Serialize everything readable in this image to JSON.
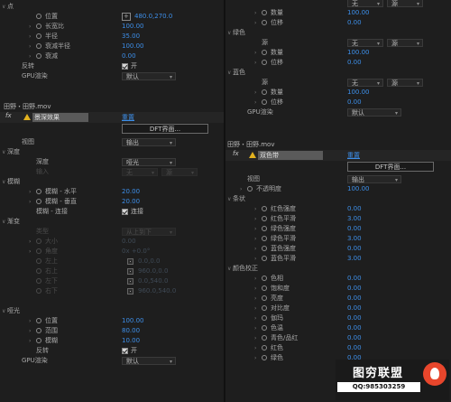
{
  "left": {
    "rows": [
      {
        "label": "点",
        "twirl": "open",
        "indent": 8
      },
      {
        "label": "位置",
        "twirl": "none",
        "indent": 40,
        "sw": true,
        "value": "480.0,270.0",
        "ptbox": true
      },
      {
        "label": "长宽比",
        "twirl": "closed",
        "indent": 40,
        "sw": true,
        "value": "100.00"
      },
      {
        "label": "半径",
        "twirl": "closed",
        "indent": 40,
        "sw": true,
        "value": "35.00"
      },
      {
        "label": "衰减半径",
        "twirl": "closed",
        "indent": 40,
        "sw": true,
        "value": "100.00"
      },
      {
        "label": "衰减",
        "twirl": "closed",
        "indent": 40,
        "sw": true,
        "value": "0.00"
      },
      {
        "label": "反转",
        "twirl": "none",
        "indent": 24,
        "check": "开"
      },
      {
        "label": "GPU渲染",
        "twirl": "none",
        "indent": 24,
        "drop": "默认"
      }
    ],
    "layer_title": "田野・田野.mov",
    "effect": {
      "name": "景深效果",
      "reset": "重置",
      "dft": "DFT界面..."
    },
    "rows2": [
      {
        "label": "视图",
        "twirl": "none",
        "indent": 24,
        "drop": "输出"
      },
      {
        "label": "深度",
        "twirl": "open",
        "indent": 8
      },
      {
        "label": "深度",
        "twirl": "none",
        "indent": 40,
        "drop": "哑光"
      },
      {
        "label": "输入",
        "twirl": "none",
        "indent": 40,
        "drop": "无",
        "drop2": "源",
        "dis": true
      },
      {
        "label": "模糊",
        "twirl": "open",
        "indent": 8
      },
      {
        "label": "模糊 - 水平",
        "twirl": "closed",
        "indent": 40,
        "sw": true,
        "value": "20.00"
      },
      {
        "label": "模糊 - 垂直",
        "twirl": "closed",
        "indent": 40,
        "sw": true,
        "value": "20.00"
      },
      {
        "label": "模糊 - 连接",
        "twirl": "none",
        "indent": 40,
        "check": "连接"
      },
      {
        "label": "渐变",
        "twirl": "open",
        "indent": 8
      },
      {
        "label": "类型",
        "twirl": "none",
        "indent": 40,
        "drop": "从上到下",
        "dis": true
      },
      {
        "label": "大小",
        "twirl": "closed",
        "indent": 40,
        "sw": true,
        "value": "0.00",
        "dis": true
      },
      {
        "label": "角度",
        "twirl": "closed",
        "indent": 40,
        "sw": true,
        "value": "0x +0.0°",
        "dis": true
      },
      {
        "label": "左上",
        "twirl": "none",
        "indent": 40,
        "sw": true,
        "value": "0.0,0.0",
        "pt": true,
        "dis": true
      },
      {
        "label": "右上",
        "twirl": "none",
        "indent": 40,
        "sw": true,
        "value": "960.0,0.0",
        "pt": true,
        "dis": true
      },
      {
        "label": "左下",
        "twirl": "none",
        "indent": 40,
        "sw": true,
        "value": "0.0,540.0",
        "pt": true,
        "dis": true
      },
      {
        "label": "右下",
        "twirl": "none",
        "indent": 40,
        "sw": true,
        "value": "960.0,540.0",
        "pt": true,
        "dis": true
      },
      {
        "label": "",
        "twirl": "none",
        "indent": 8
      },
      {
        "label": "哑光",
        "twirl": "open",
        "indent": 8
      },
      {
        "label": "位置",
        "twirl": "closed",
        "indent": 40,
        "sw": true,
        "value": "100.00"
      },
      {
        "label": "范围",
        "twirl": "closed",
        "indent": 40,
        "sw": true,
        "value": "80.00"
      },
      {
        "label": "模糊",
        "twirl": "closed",
        "indent": 40,
        "sw": true,
        "value": "10.00"
      },
      {
        "label": "反转",
        "twirl": "none",
        "indent": 40,
        "check": "开"
      },
      {
        "label": "GPU渲染",
        "twirl": "none",
        "indent": 24,
        "drop": "默认"
      }
    ]
  },
  "right": {
    "rows": [
      {
        "label": "",
        "twirl": "none",
        "indent": 8,
        "drop": "无",
        "drop2": "源"
      },
      {
        "label": "数量",
        "twirl": "closed",
        "indent": 40,
        "sw": true,
        "value": "100.00"
      },
      {
        "label": "位移",
        "twirl": "closed",
        "indent": 40,
        "sw": true,
        "value": "0.00"
      },
      {
        "label": "绿色",
        "twirl": "open",
        "indent": 8
      },
      {
        "label": "源",
        "twirl": "none",
        "indent": 40,
        "drop": "无",
        "drop2": "源"
      },
      {
        "label": "数量",
        "twirl": "closed",
        "indent": 40,
        "sw": true,
        "value": "100.00"
      },
      {
        "label": "位移",
        "twirl": "closed",
        "indent": 40,
        "sw": true,
        "value": "0.00"
      },
      {
        "label": "蓝色",
        "twirl": "open",
        "indent": 8
      },
      {
        "label": "源",
        "twirl": "none",
        "indent": 40,
        "drop": "无",
        "drop2": "源"
      },
      {
        "label": "数量",
        "twirl": "closed",
        "indent": 40,
        "sw": true,
        "value": "100.00"
      },
      {
        "label": "位移",
        "twirl": "closed",
        "indent": 40,
        "sw": true,
        "value": "0.00"
      },
      {
        "label": "GPU渲染",
        "twirl": "none",
        "indent": 24,
        "drop": "默认"
      }
    ],
    "layer_title": "田野・田野.mov",
    "effect": {
      "name": "双色带",
      "reset": "重置",
      "dft": "DFT界面..."
    },
    "rows2": [
      {
        "label": "视图",
        "twirl": "none",
        "indent": 24,
        "drop": "输出"
      },
      {
        "label": "不透明度",
        "twirl": "closed",
        "indent": 24,
        "sw": true,
        "value": "100.00"
      },
      {
        "label": "条状",
        "twirl": "open",
        "indent": 8
      },
      {
        "label": "红色强度",
        "twirl": "closed",
        "indent": 40,
        "sw": true,
        "value": "0.00"
      },
      {
        "label": "红色平滑",
        "twirl": "closed",
        "indent": 40,
        "sw": true,
        "value": "3.00"
      },
      {
        "label": "绿色强度",
        "twirl": "closed",
        "indent": 40,
        "sw": true,
        "value": "0.00"
      },
      {
        "label": "绿色平滑",
        "twirl": "closed",
        "indent": 40,
        "sw": true,
        "value": "3.00"
      },
      {
        "label": "蓝色强度",
        "twirl": "closed",
        "indent": 40,
        "sw": true,
        "value": "0.00"
      },
      {
        "label": "蓝色平滑",
        "twirl": "closed",
        "indent": 40,
        "sw": true,
        "value": "3.00"
      },
      {
        "label": "颜色校正",
        "twirl": "open",
        "indent": 8
      },
      {
        "label": "色相",
        "twirl": "closed",
        "indent": 40,
        "sw": true,
        "value": "0.00"
      },
      {
        "label": "饱和度",
        "twirl": "closed",
        "indent": 40,
        "sw": true,
        "value": "0.00"
      },
      {
        "label": "亮度",
        "twirl": "closed",
        "indent": 40,
        "sw": true,
        "value": "0.00"
      },
      {
        "label": "对比度",
        "twirl": "closed",
        "indent": 40,
        "sw": true,
        "value": "0.00"
      },
      {
        "label": "伽玛",
        "twirl": "closed",
        "indent": 40,
        "sw": true,
        "value": "0.00"
      },
      {
        "label": "色温",
        "twirl": "closed",
        "indent": 40,
        "sw": true,
        "value": "0.00"
      },
      {
        "label": "青色/品红",
        "twirl": "closed",
        "indent": 40,
        "sw": true,
        "value": "0.00"
      },
      {
        "label": "红色",
        "twirl": "closed",
        "indent": 40,
        "sw": true,
        "value": "0.00"
      },
      {
        "label": "绿色",
        "twirl": "closed",
        "indent": 40,
        "sw": true,
        "value": "0.00"
      }
    ]
  },
  "watermark": {
    "title": "图穷联盟",
    "qq": "QQ:985303259"
  },
  "colors": {
    "accent": "#3d8ee8",
    "warning": "#e2b21f",
    "panel": "#1e1e1e"
  }
}
